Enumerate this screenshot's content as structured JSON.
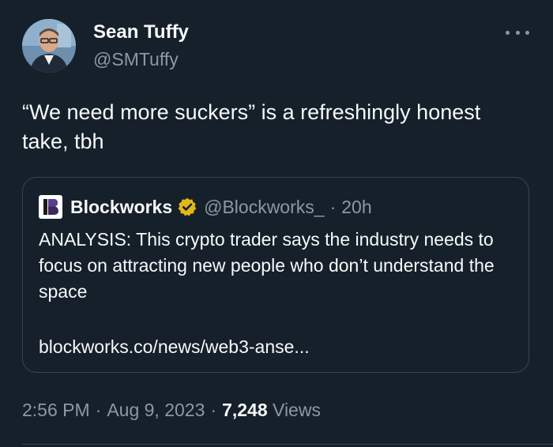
{
  "tweet": {
    "author": {
      "display_name": "Sean Tuffy",
      "handle": "@SMTuffy",
      "avatar_icon": "profile-photo"
    },
    "more_icon": "ellipsis-icon",
    "text": "“We need more suckers” is a refreshingly honest take, tbh",
    "quoted": {
      "logo_letter": "B",
      "name": "Blockworks",
      "badge_icon": "verified-gold-badge",
      "handle": "@Blockworks_",
      "separator": "·",
      "time": "20h",
      "text": "ANALYSIS: This crypto trader says the industry needs to focus on attracting new people who don’t understand the space",
      "link": "blockworks.co/news/web3-anse..."
    },
    "meta": {
      "time": "2:56 PM",
      "sep1": "·",
      "date": "Aug 9, 2023",
      "sep2": "·",
      "views_count": "7,248",
      "views_label": "Views"
    }
  },
  "colors": {
    "background": "#15202b",
    "primary_text": "#f7f9f9",
    "secondary_text": "#8b98a5",
    "border": "#38444d",
    "badge_gold": "#e2b719"
  }
}
